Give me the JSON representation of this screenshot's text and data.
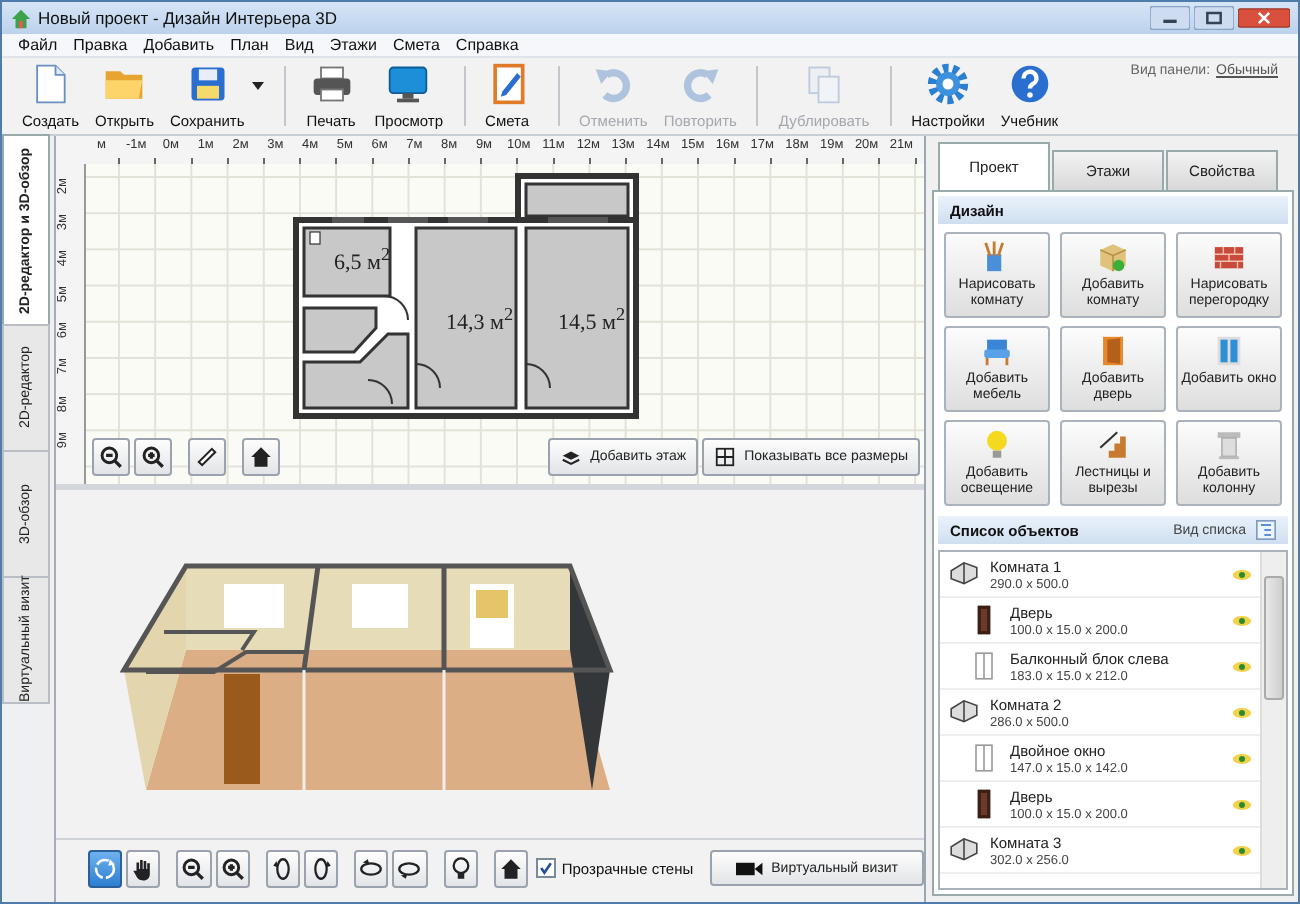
{
  "window": {
    "title": "Новый проект - Дизайн Интерьера 3D"
  },
  "menu": [
    "Файл",
    "Правка",
    "Добавить",
    "План",
    "Вид",
    "Этажи",
    "Смета",
    "Справка"
  ],
  "toolbar": [
    [
      {
        "label": "Создать",
        "disabled": false,
        "dropdown": false
      },
      {
        "label": "Открыть",
        "disabled": false,
        "dropdown": false
      },
      {
        "label": "Сохранить",
        "disabled": false,
        "dropdown": true
      }
    ],
    [
      {
        "label": "Печать",
        "disabled": false,
        "dropdown": false
      },
      {
        "label": "Просмотр",
        "disabled": false,
        "dropdown": false
      }
    ],
    [
      {
        "label": "Смета",
        "disabled": false,
        "dropdown": false
      }
    ],
    [
      {
        "label": "Отменить",
        "disabled": true,
        "dropdown": false
      },
      {
        "label": "Повторить",
        "disabled": true,
        "dropdown": false
      }
    ],
    [
      {
        "label": "Дублировать",
        "disabled": true,
        "dropdown": false
      }
    ],
    [
      {
        "label": "Настройки",
        "disabled": false,
        "dropdown": false
      },
      {
        "label": "Учебник",
        "disabled": false,
        "dropdown": false
      }
    ]
  ],
  "panel_view": {
    "label": "Вид панели:",
    "value": "Обычный"
  },
  "side_tabs": [
    {
      "label": "2D-редактор и 3D-обзор",
      "selected": true
    },
    {
      "label": "2D-редактор",
      "selected": false
    },
    {
      "label": "3D-обзор",
      "selected": false
    },
    {
      "label": "Виртуальный визит",
      "selected": false
    }
  ],
  "plan": {
    "ruler_x": [
      "м",
      "-1м",
      "0м",
      "1м",
      "2м",
      "3м",
      "4м",
      "5м",
      "6м",
      "7м",
      "8м",
      "9м",
      "10м",
      "11м",
      "12м",
      "13м",
      "14м",
      "15м",
      "16м",
      "17м",
      "18м",
      "19м",
      "20м",
      "21м"
    ],
    "ruler_y": [
      "2м",
      "3м",
      "4м",
      "5м",
      "6м",
      "7м",
      "8м",
      "9м"
    ],
    "rooms": [
      {
        "area": "6,5 м$^{2}$"
      },
      {
        "area": "14,3 м$^{2}$"
      },
      {
        "area": "14,5 м$^{2}$"
      }
    ],
    "buttons": [
      "Добавить этаж",
      "Показывать все размеры"
    ]
  },
  "view3d": {
    "tools": [
      {
        "selected": true
      },
      {
        "selected": false
      },
      {
        "selected": false
      },
      {
        "selected": false
      },
      {
        "selected": false
      },
      {
        "selected": false
      },
      {
        "selected": false
      },
      {
        "selected": false
      },
      {
        "selected": false
      },
      {
        "selected": false
      }
    ],
    "transparent_walls": {
      "label": "Прозрачные стены",
      "checked": true
    },
    "tour_button": "Виртуальный визит"
  },
  "right_tabs": [
    {
      "label": "Проект",
      "selected": true
    },
    {
      "label": "Этажи",
      "selected": false
    },
    {
      "label": "Свойства",
      "selected": false
    }
  ],
  "design": {
    "title": "Дизайн",
    "buttons": [
      "Нарисовать комнату",
      "Добавить комнату",
      "Нарисовать перегородку",
      "Добавить мебель",
      "Добавить дверь",
      "Добавить окно",
      "Добавить освещение",
      "Лестницы и вырезы",
      "Добавить колонну"
    ]
  },
  "objects": {
    "title": "Список объектов",
    "view_label": "Вид списка",
    "items": [
      {
        "kind": "room",
        "name": "Комната 1",
        "size": "290.0 x 500.0",
        "visible": true,
        "children": [
          {
            "kind": "door",
            "name": "Дверь",
            "size": "100.0 x 15.0 x 200.0",
            "visible": true
          },
          {
            "kind": "window",
            "name": "Балконный блок слева",
            "size": "183.0 x 15.0 x 212.0",
            "visible": true
          }
        ]
      },
      {
        "kind": "room",
        "name": "Комната 2",
        "size": "286.0 x 500.0",
        "visible": true,
        "children": [
          {
            "kind": "window",
            "name": "Двойное окно",
            "size": "147.0 x 15.0 x 142.0",
            "visible": true
          },
          {
            "kind": "door",
            "name": "Дверь",
            "size": "100.0 x 15.0 x 200.0",
            "visible": true
          }
        ]
      },
      {
        "kind": "room",
        "name": "Комната 3",
        "size": "302.0 x 256.0",
        "visible": true
      }
    ]
  }
}
